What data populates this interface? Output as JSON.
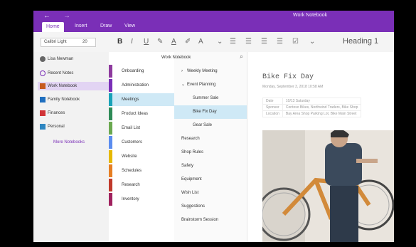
{
  "window": {
    "title": "Work Notebook"
  },
  "tabs": [
    "Home",
    "Insert",
    "Draw",
    "View"
  ],
  "ribbon": {
    "font_size": "Calibri Light",
    "size_value": "20",
    "heading_style": "Heading 1"
  },
  "notebooks": {
    "user": "Lisa Newman",
    "items": [
      {
        "label": "Recent Notes",
        "color": "#7a2fb7"
      },
      {
        "label": "Work Notebook",
        "color": "#c65a1e"
      },
      {
        "label": "Family Notebook",
        "color": "#1f6fbf"
      },
      {
        "label": "Finances",
        "color": "#d13438"
      },
      {
        "label": "Personal",
        "color": "#2e86c1"
      }
    ],
    "more_label": "More Notebooks"
  },
  "sections": {
    "header": "Work Notebook",
    "items": [
      {
        "label": "Onboarding",
        "color": "#8e3a9e"
      },
      {
        "label": "Administration",
        "color": "#7a2fb7"
      },
      {
        "label": "Meetings",
        "color": "#17a2b8"
      },
      {
        "label": "Product Ideas",
        "color": "#2e8b57"
      },
      {
        "label": "Email List",
        "color": "#6aa84f"
      },
      {
        "label": "Customers",
        "color": "#5b8def"
      },
      {
        "label": "Website",
        "color": "#e6b800"
      },
      {
        "label": "Schedules",
        "color": "#e67e22"
      },
      {
        "label": "Research",
        "color": "#c0392b"
      },
      {
        "label": "Inventory",
        "color": "#a0215e"
      }
    ]
  },
  "pages": [
    {
      "label": "Weekly Meeting",
      "indent": false
    },
    {
      "label": "Event Planning",
      "indent": false
    },
    {
      "label": "Summer Sale",
      "indent": true
    },
    {
      "label": "Bike Fix Day",
      "indent": true
    },
    {
      "label": "Gear Sale",
      "indent": true
    },
    {
      "label": "Research",
      "indent": false
    },
    {
      "label": "Shop Rules",
      "indent": false
    },
    {
      "label": "Safety",
      "indent": false
    },
    {
      "label": "Equipment",
      "indent": false
    },
    {
      "label": "Wish List",
      "indent": false
    },
    {
      "label": "Suggestions",
      "indent": false
    },
    {
      "label": "Brainstorm Session",
      "indent": false
    }
  ],
  "page": {
    "title": "Bike Fix Day",
    "date": "Monday, September 3, 2018    10:58 AM",
    "meta": [
      {
        "k": "Date",
        "v": "10/13 Saturday"
      },
      {
        "k": "Sponsor",
        "v": "Contoso Bikes, Northwind Traders, Bike Shop"
      },
      {
        "k": "Location",
        "v": "Bay Area Shop Parking Lot, Bike Main Street"
      }
    ]
  }
}
